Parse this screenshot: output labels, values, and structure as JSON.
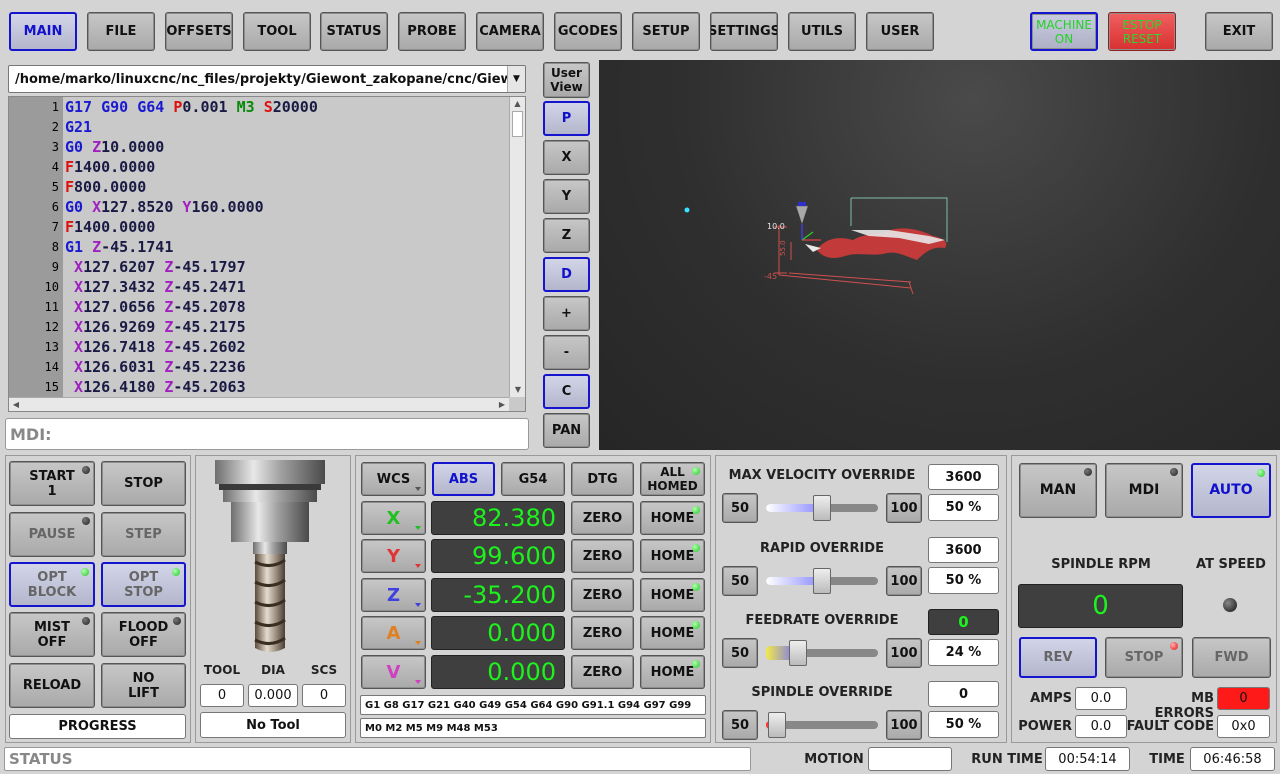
{
  "top_nav": [
    "MAIN",
    "FILE",
    "OFFSETS",
    "TOOL",
    "STATUS",
    "PROBE",
    "CAMERA",
    "GCODES",
    "SETUP",
    "SETTINGS",
    "UTILS",
    "USER"
  ],
  "machine_btn": {
    "line1": "MACHINE",
    "line2": "ON"
  },
  "estop_btn": {
    "line1": "ESTOP",
    "line2": "RESET"
  },
  "exit_label": "EXIT",
  "file_path": "/home/marko/linuxcnc/nc_files/projekty/Giewont_zakopane/cnc/Giewont_zakopar",
  "gcode": [
    {
      "n": "1",
      "segs": [
        [
          "G17 ",
          "#1a1ad0"
        ],
        [
          "G90 ",
          "#1a1ad0"
        ],
        [
          "G64 ",
          "#1a1ad0"
        ],
        [
          "P",
          "#e01010"
        ],
        [
          "0.001 ",
          "#1a1a44"
        ],
        [
          "M3 ",
          "#0a8a0a"
        ],
        [
          "S",
          "#e01010"
        ],
        [
          "20000",
          "#1a1a44"
        ]
      ]
    },
    {
      "n": "2",
      "segs": [
        [
          "G21",
          "#1a1ad0"
        ]
      ]
    },
    {
      "n": "3",
      "segs": [
        [
          "G0 ",
          "#1a1ad0"
        ],
        [
          "Z",
          "#a020c0"
        ],
        [
          "10.0000",
          "#1a1a44"
        ]
      ]
    },
    {
      "n": "4",
      "segs": [
        [
          "F",
          "#e01010"
        ],
        [
          "1400.0000",
          "#1a1a44"
        ]
      ]
    },
    {
      "n": "5",
      "segs": [
        [
          "F",
          "#e01010"
        ],
        [
          "800.0000",
          "#1a1a44"
        ]
      ]
    },
    {
      "n": "6",
      "segs": [
        [
          "G0 ",
          "#1a1ad0"
        ],
        [
          "X",
          "#a020c0"
        ],
        [
          "127.8520 ",
          "#1a1a44"
        ],
        [
          "Y",
          "#a020c0"
        ],
        [
          "160.0000",
          "#1a1a44"
        ]
      ]
    },
    {
      "n": "7",
      "segs": [
        [
          "F",
          "#e01010"
        ],
        [
          "1400.0000",
          "#1a1a44"
        ]
      ]
    },
    {
      "n": "8",
      "segs": [
        [
          "G1 ",
          "#1a1ad0"
        ],
        [
          "Z",
          "#a020c0"
        ],
        [
          "-45.1741",
          "#1a1a44"
        ]
      ]
    },
    {
      "n": "9",
      "segs": [
        [
          " X",
          "#a020c0"
        ],
        [
          "127.6207 ",
          "#1a1a44"
        ],
        [
          "Z",
          "#a020c0"
        ],
        [
          "-45.1797",
          "#1a1a44"
        ]
      ]
    },
    {
      "n": "10",
      "segs": [
        [
          " X",
          "#a020c0"
        ],
        [
          "127.3432 ",
          "#1a1a44"
        ],
        [
          "Z",
          "#a020c0"
        ],
        [
          "-45.2471",
          "#1a1a44"
        ]
      ]
    },
    {
      "n": "11",
      "segs": [
        [
          " X",
          "#a020c0"
        ],
        [
          "127.0656 ",
          "#1a1a44"
        ],
        [
          "Z",
          "#a020c0"
        ],
        [
          "-45.2078",
          "#1a1a44"
        ]
      ]
    },
    {
      "n": "12",
      "segs": [
        [
          " X",
          "#a020c0"
        ],
        [
          "126.9269 ",
          "#1a1a44"
        ],
        [
          "Z",
          "#a020c0"
        ],
        [
          "-45.2175",
          "#1a1a44"
        ]
      ]
    },
    {
      "n": "13",
      "segs": [
        [
          " X",
          "#a020c0"
        ],
        [
          "126.7418 ",
          "#1a1a44"
        ],
        [
          "Z",
          "#a020c0"
        ],
        [
          "-45.2602",
          "#1a1a44"
        ]
      ]
    },
    {
      "n": "14",
      "segs": [
        [
          " X",
          "#a020c0"
        ],
        [
          "126.6031 ",
          "#1a1a44"
        ],
        [
          "Z",
          "#a020c0"
        ],
        [
          "-45.2236",
          "#1a1a44"
        ]
      ]
    },
    {
      "n": "15",
      "segs": [
        [
          " X",
          "#a020c0"
        ],
        [
          "126.4180 ",
          "#1a1a44"
        ],
        [
          "Z",
          "#a020c0"
        ],
        [
          "-45.2063",
          "#1a1a44"
        ]
      ]
    }
  ],
  "mdi_placeholder": "MDI:",
  "view_buttons": {
    "user_view_1": "User",
    "user_view_2": "View",
    "p": "P",
    "x": "X",
    "y": "Y",
    "z": "Z",
    "d": "D",
    "plus": "+",
    "minus": "-",
    "c": "C",
    "pan": "PAN"
  },
  "preview_labels": {
    "z_top": "10.0",
    "z_side": "55.0",
    "z_bottom": "-45"
  },
  "run_controls": {
    "start_1": "START",
    "start_2": "1",
    "stop": "STOP",
    "pause": "PAUSE",
    "step": "STEP",
    "opt_block_1": "OPT",
    "opt_block_2": "BLOCK",
    "opt_stop_1": "OPT",
    "opt_stop_2": "STOP",
    "mist_1": "MIST",
    "mist_2": "OFF",
    "flood_1": "FLOOD",
    "flood_2": "OFF",
    "reload": "RELOAD",
    "no_lift_1": "NO",
    "no_lift_2": "LIFT",
    "progress": "PROGRESS"
  },
  "tool_info": {
    "tool_label": "TOOL",
    "dia_label": "DIA",
    "scs_label": "SCS",
    "tool": "0",
    "dia": "0.000",
    "scs": "0",
    "name": "No Tool"
  },
  "dro": {
    "wcs": "WCS",
    "abs": "ABS",
    "g54": "G54",
    "dtg": "DTG",
    "all_homed_1": "ALL",
    "all_homed_2": "HOMED",
    "zero": "ZERO",
    "home": "HOME",
    "axes": [
      {
        "name": "X",
        "value": "82.380",
        "color": "#20c020"
      },
      {
        "name": "Y",
        "value": "99.600",
        "color": "#e03535"
      },
      {
        "name": "Z",
        "value": "-35.200",
        "color": "#4040e0"
      },
      {
        "name": "A",
        "value": "0.000",
        "color": "#e08020"
      },
      {
        "name": "V",
        "value": "0.000",
        "color": "#d040c0"
      }
    ],
    "gcodes_active": "G1 G8 G17 G21 G40 G49 G54 G64 G90 G91.1 G94 G97 G99",
    "mcodes_active": "M0 M2 M5 M9 M48 M53"
  },
  "overrides": [
    {
      "title": "MAX VELOCITY OVERRIDE",
      "value": "3600",
      "pct": "50 %",
      "fraction": 0.5,
      "min": "50",
      "max": "100",
      "style": "blue",
      "value_dark": false
    },
    {
      "title": "RAPID OVERRIDE",
      "value": "3600",
      "pct": "50 %",
      "fraction": 0.5,
      "min": "50",
      "max": "100",
      "style": "blue",
      "value_dark": false
    },
    {
      "title": "FEEDRATE OVERRIDE",
      "value": "0",
      "pct": "24 %",
      "fraction": 0.24,
      "min": "50",
      "max": "100",
      "style": "yellow",
      "value_dark": true
    },
    {
      "title": "SPINDLE OVERRIDE",
      "value": "0",
      "pct": "50 %",
      "fraction": 0.02,
      "min": "50",
      "max": "100",
      "style": "red",
      "value_dark": false
    }
  ],
  "mode": {
    "man": "MAN",
    "mdi": "MDI",
    "auto": "AUTO"
  },
  "spindle": {
    "rpm_label": "SPINDLE RPM",
    "at_speed_label": "AT SPEED",
    "rpm": "0",
    "rev": "REV",
    "stop": "STOP",
    "fwd": "FWD",
    "amps_label": "AMPS",
    "amps": "0.0",
    "mb_errors_label": "MB ERRORS",
    "mb_errors": "0",
    "power_label": "POWER",
    "power": "0.0",
    "fault_label": "FAULT CODE",
    "fault": "0x0"
  },
  "status_bar": {
    "status": "STATUS",
    "motion_label": "MOTION",
    "motion": "",
    "run_time_label": "RUN TIME",
    "run_time": "00:54:14",
    "time_label": "TIME",
    "time": "06:46:58"
  }
}
